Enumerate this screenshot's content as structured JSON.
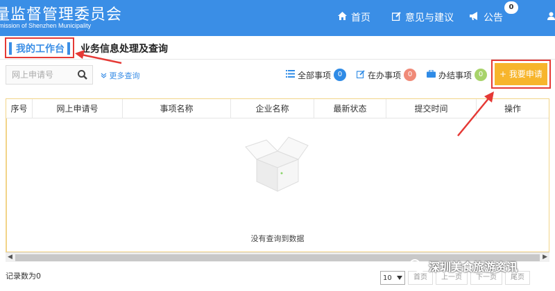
{
  "header": {
    "title": "量监督管理委员会",
    "subtitle": "mission of Shenzhen Municipality",
    "nav": {
      "home": "首页",
      "feedback": "意见与建议",
      "notice": "公告",
      "notice_count": "0"
    }
  },
  "tabs": {
    "workbench": "我的工作台",
    "business": "业务信息处理及查询"
  },
  "toolbar": {
    "search_placeholder": "网上申请号",
    "more_query": "更多查询",
    "all_label": "全部事项",
    "all_count": "0",
    "doing_label": "在办事项",
    "doing_count": "0",
    "done_label": "办结事项",
    "done_count": "0",
    "apply_label": "我要申请"
  },
  "table": {
    "columns": [
      "序号",
      "网上申请号",
      "事项名称",
      "企业名称",
      "最新状态",
      "提交时间",
      "操作"
    ],
    "empty_text": "没有查询到数据"
  },
  "footer": {
    "records": "记录数为0",
    "page_size": "10",
    "first": "首页",
    "prev": "上一页",
    "next": "下一页",
    "last": "尾页"
  },
  "watermark": "深圳美食旅游资讯",
  "colors": {
    "header_bg": "#3a8ee6",
    "apply_bg": "#f7b52c",
    "all_badge": "#2f8be6",
    "doing_badge": "#f08a78",
    "done_badge": "#a8d36a",
    "highlight": "#e53935"
  },
  "icons": {
    "home": "home-icon",
    "feedback": "edit-icon",
    "notice": "megaphone-icon",
    "user": "user-icon",
    "search": "search-icon",
    "more": "chevron-down-icon",
    "all": "list-icon",
    "doing": "edit-icon",
    "done": "briefcase-icon",
    "apply": "plus-icon"
  }
}
